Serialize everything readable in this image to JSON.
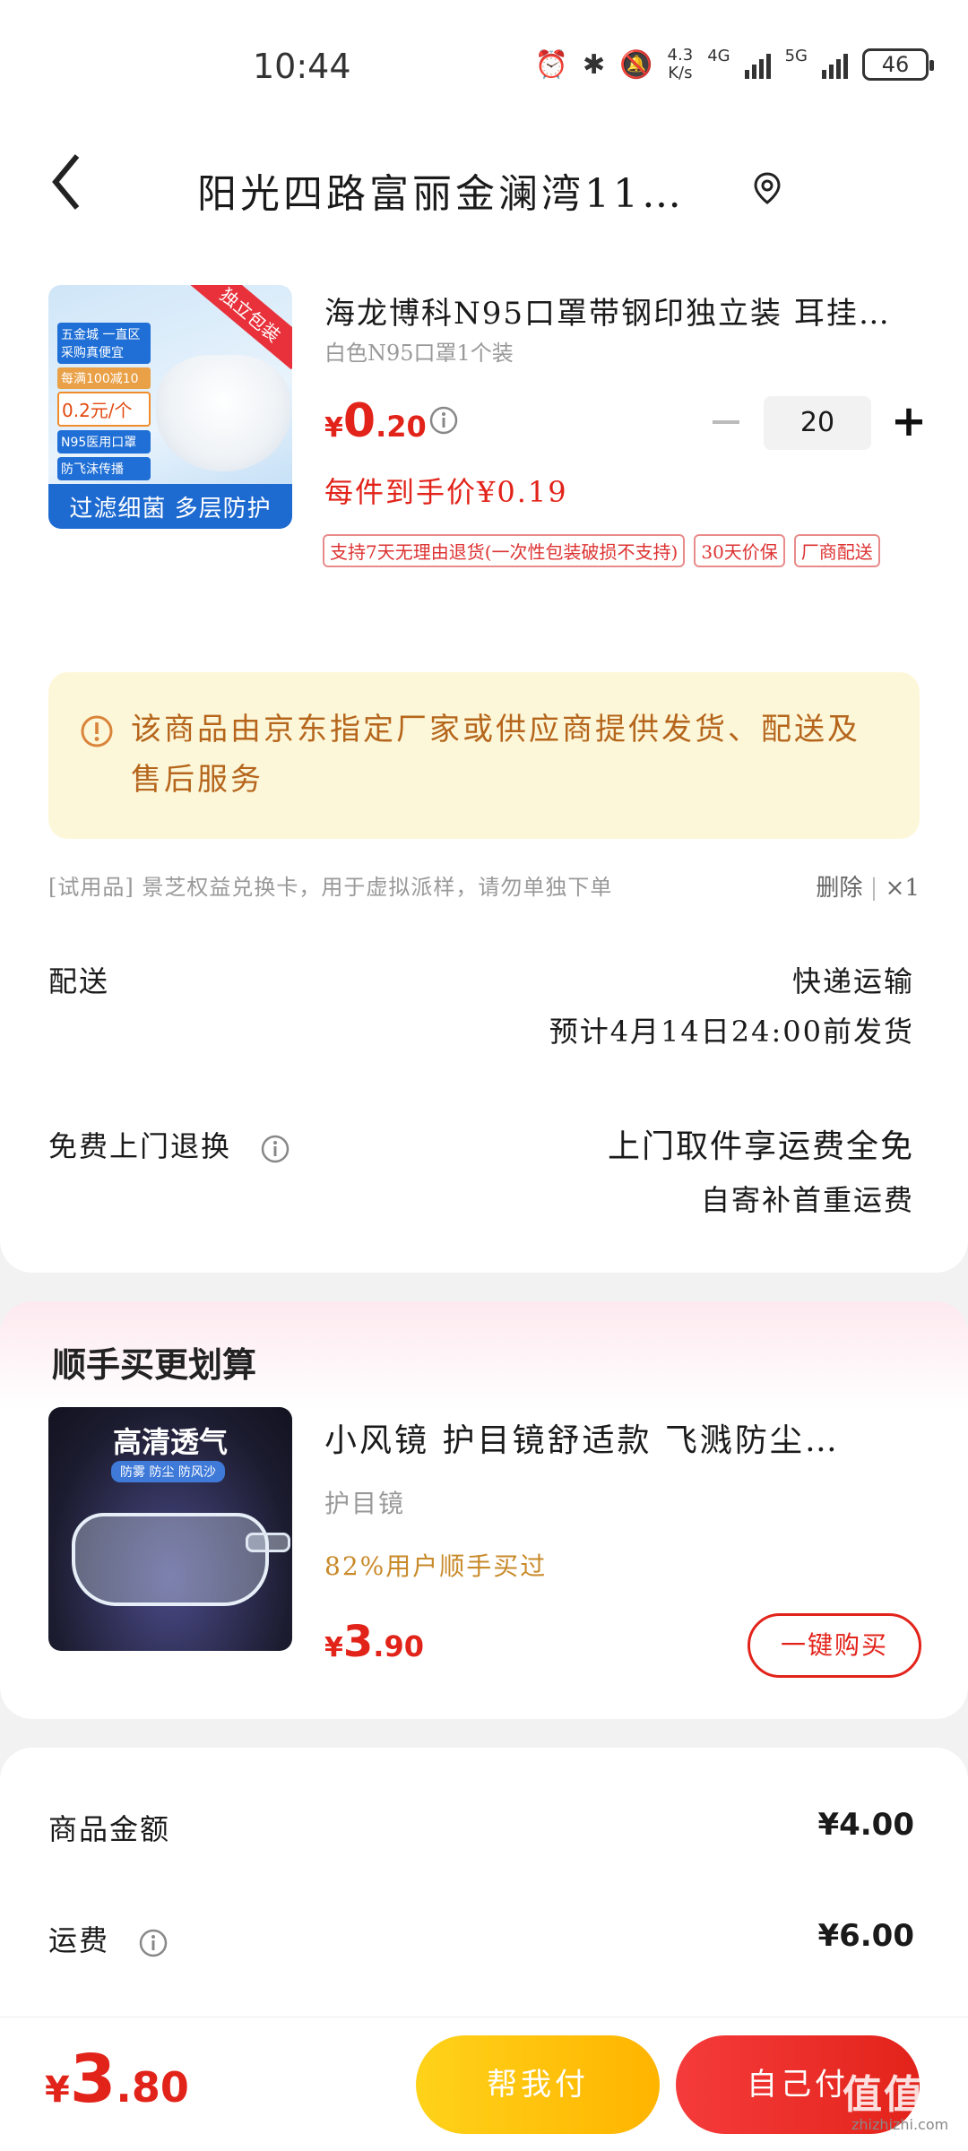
{
  "status_bar": {
    "time": "10:44",
    "net_speed_value": "4.3",
    "net_speed_unit": "K/s",
    "signal1_label": "4G",
    "signal2_label": "5G",
    "battery": "46"
  },
  "header": {
    "title": "阳光四路富丽金澜湾11…"
  },
  "product": {
    "title": "海龙博科N95口罩带钢印独立装 耳挂…",
    "spec": "白色N95口罩1个装",
    "price_symbol": "¥",
    "price_int": "0",
    "price_dec": ".20",
    "quantity": "20",
    "unit_price": "每件到手价¥0.19",
    "tags": [
      "支持7天无理由退货(一次性包装破损不支持)",
      "30天价保",
      "厂商配送"
    ],
    "image": {
      "corner_tag": "独立包装",
      "promo1": "五金城 一直区 采购真便宜",
      "promo2": "每满100减10",
      "promo3": "0.2元/个",
      "promo4": "N95医用口罩",
      "promo5": "防飞沫传播",
      "bottom_text": "过滤细菌 多层防护"
    }
  },
  "notice": {
    "text": "该商品由京东指定厂家或供应商提供发货、配送及售后服务"
  },
  "trial": {
    "text": "[试用品]  景芝权益兑换卡，用于虚拟派样，请勿单独下单",
    "delete_label": "删除",
    "count": "×1"
  },
  "delivery": {
    "label": "配送",
    "method": "快递运输",
    "estimate": "预计4月14日24:00前发货"
  },
  "returns": {
    "label": "免费上门退换",
    "main": "上门取件享运费全免",
    "sub": "自寄补首重运费"
  },
  "recommend": {
    "title": "顺手买更划算",
    "image_title": "高清透气",
    "image_sub": "防雾 防尘 防风沙",
    "name": "小风镜  护目镜舒适款 飞溅防尘…",
    "category": "护目镜",
    "bought": "82%用户顺手买过",
    "price_symbol": "¥",
    "price_int": "3",
    "price_dec": ".90",
    "buy_label": "一键购买"
  },
  "summary": {
    "goods_label": "商品金额",
    "goods_value": "¥4.00",
    "shipping_label": "运费",
    "shipping_value": "¥6.00"
  },
  "bottom": {
    "total_symbol": "¥",
    "total_int": "3",
    "total_dec": ".80",
    "help_pay_label": "帮我付",
    "self_pay_label": "自己付",
    "watermark": "值值值",
    "watermark_sub": "zhizhizhi.com"
  },
  "colors": {
    "accent_red": "#e2231a",
    "notice_bg": "#fdf7d9",
    "notice_text": "#b5661c",
    "help_pay_yellow": "#ffc20e"
  }
}
